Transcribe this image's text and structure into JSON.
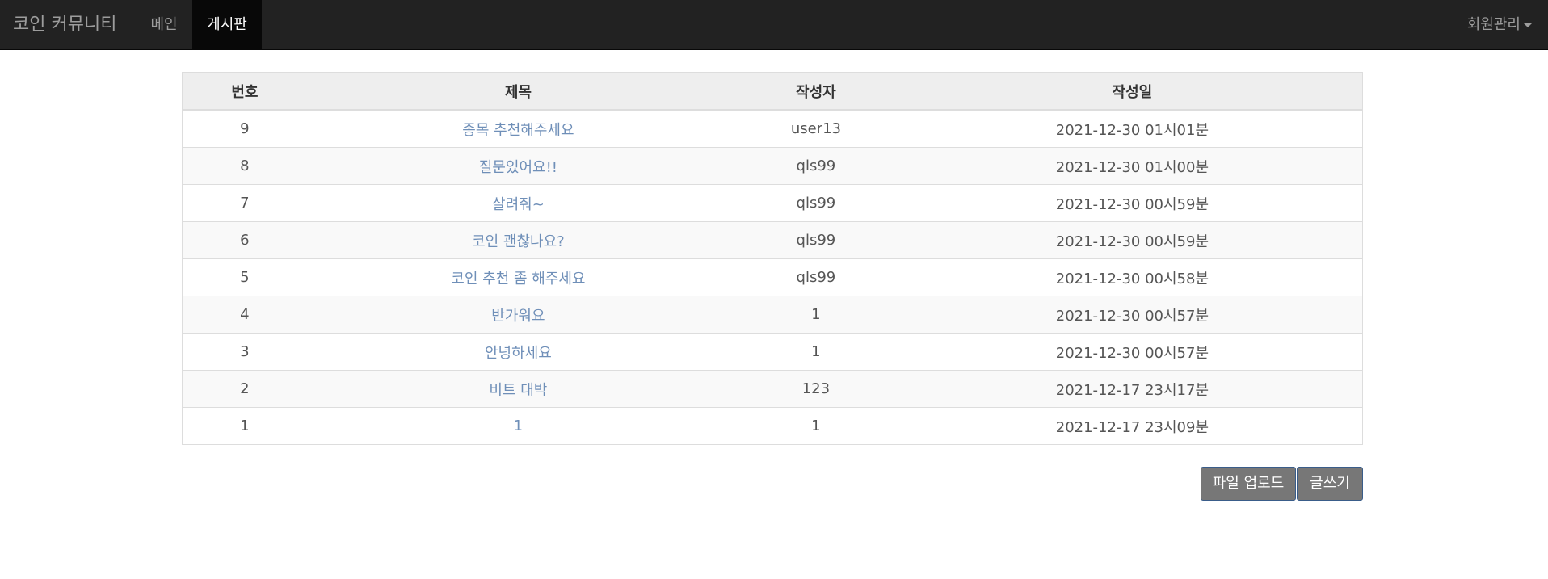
{
  "navbar": {
    "brand": "코인 커뮤니티",
    "items": [
      {
        "label": "메인"
      },
      {
        "label": "게시판"
      }
    ],
    "member_menu": "회원관리"
  },
  "board": {
    "headers": [
      "번호",
      "제목",
      "작성자",
      "작성일"
    ],
    "rows": [
      {
        "num": "9",
        "title": "종목 추천해주세요",
        "author": "user13",
        "date": "2021-12-30 01시01분"
      },
      {
        "num": "8",
        "title": "질문있어요!!",
        "author": "qls99",
        "date": "2021-12-30 01시00분"
      },
      {
        "num": "7",
        "title": "살려줘~",
        "author": "qls99",
        "date": "2021-12-30 00시59분"
      },
      {
        "num": "6",
        "title": "코인 괜찮나요?",
        "author": "qls99",
        "date": "2021-12-30 00시59분"
      },
      {
        "num": "5",
        "title": "코인 추천 좀 해주세요",
        "author": "qls99",
        "date": "2021-12-30 00시58분"
      },
      {
        "num": "4",
        "title": "반가워요",
        "author": "1",
        "date": "2021-12-30 00시57분"
      },
      {
        "num": "3",
        "title": "안녕하세요",
        "author": "1",
        "date": "2021-12-30 00시57분"
      },
      {
        "num": "2",
        "title": "비트 대박",
        "author": "123",
        "date": "2021-12-17 23시17분"
      },
      {
        "num": "1",
        "title": "1",
        "author": "1",
        "date": "2021-12-17 23시09분"
      }
    ]
  },
  "actions": {
    "upload_label": "파일 업로드",
    "write_label": "글쓰기"
  },
  "colors": {
    "navbar_bg": "#222222",
    "active_tab_bg": "#080808",
    "link": "#6f8fb8",
    "button_bg": "#777777"
  }
}
